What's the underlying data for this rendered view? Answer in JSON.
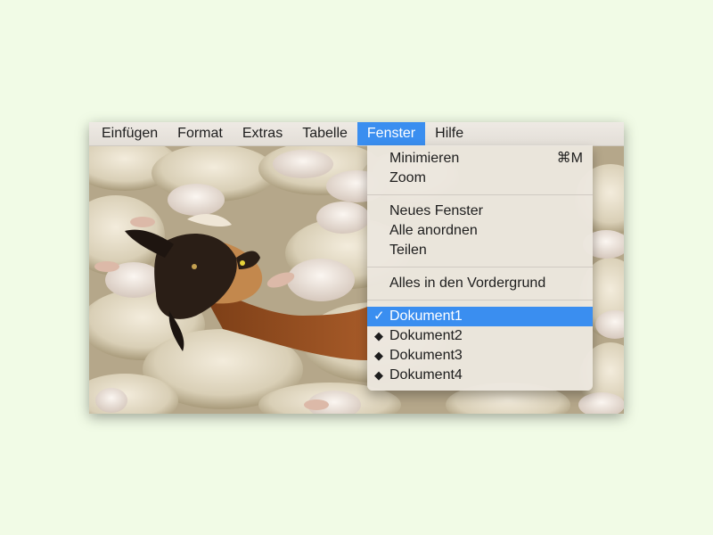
{
  "menubar": {
    "items": [
      "Einfügen",
      "Format",
      "Extras",
      "Tabelle",
      "Fenster",
      "Hilfe"
    ],
    "active": "Fenster"
  },
  "fenster_menu": {
    "minimize": {
      "label": "Minimieren",
      "shortcut": "⌘M"
    },
    "zoom": {
      "label": "Zoom"
    },
    "new_window": {
      "label": "Neues Fenster"
    },
    "arrange_all": {
      "label": "Alle anordnen"
    },
    "split": {
      "label": "Teilen"
    },
    "bring_all_front": {
      "label": "Alles in den Vordergrund"
    },
    "documents": [
      {
        "label": "Dokument1",
        "mark": "✓",
        "selected": true
      },
      {
        "label": "Dokument2",
        "mark": "◆",
        "selected": false
      },
      {
        "label": "Dokument3",
        "mark": "◆",
        "selected": false
      },
      {
        "label": "Dokument4",
        "mark": "◆",
        "selected": false
      }
    ]
  },
  "colors": {
    "page_background": "#f1fbe6",
    "highlight": "#3a8ef0",
    "menu_background": "#ece7df"
  },
  "background_image": "flock-of-sheep-with-goat-photo"
}
